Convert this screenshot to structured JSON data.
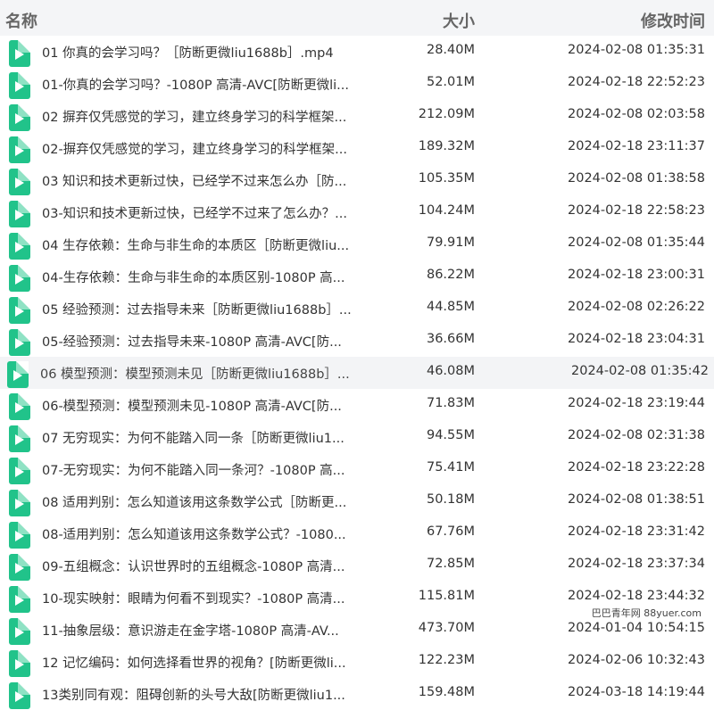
{
  "header": {
    "name": "名称",
    "size": "大小",
    "modified": "修改时间"
  },
  "files": [
    {
      "name": "01 你真的会学习吗？［防断更微liu1688b］.mp4",
      "size": "28.40M",
      "date": "2024-02-08 01:35:31"
    },
    {
      "name": "01-你真的会学习吗？-1080P 高清-AVC[防断更微li...",
      "size": "52.01M",
      "date": "2024-02-18 22:52:23"
    },
    {
      "name": "02 摒弃仅凭感觉的学习，建立终身学习的科学框架...",
      "size": "212.09M",
      "date": "2024-02-08 02:03:58"
    },
    {
      "name": "02-摒弃仅凭感觉的学习，建立终身学习的科学框架...",
      "size": "189.32M",
      "date": "2024-02-18 23:11:37"
    },
    {
      "name": "03 知识和技术更新过快，已经学不过来怎么办［防...",
      "size": "105.35M",
      "date": "2024-02-08 01:38:58"
    },
    {
      "name": "03-知识和技术更新过快，已经学不过来了怎么办？...",
      "size": "104.24M",
      "date": "2024-02-18 22:58:23"
    },
    {
      "name": "04 生存依赖：生命与非生命的本质区［防断更微liu...",
      "size": "79.91M",
      "date": "2024-02-08 01:35:44"
    },
    {
      "name": "04-生存依赖：生命与非生命的本质区别-1080P 高...",
      "size": "86.22M",
      "date": "2024-02-18 23:00:31"
    },
    {
      "name": "05 经验预测：过去指导未来［防断更微liu1688b］...",
      "size": "44.85M",
      "date": "2024-02-08 02:26:22"
    },
    {
      "name": "05-经验预测：过去指导未来-1080P 高清-AVC[防...",
      "size": "36.66M",
      "date": "2024-02-18 23:04:31"
    },
    {
      "name": "06 模型预测：模型预测未见［防断更微liu1688b］...",
      "size": "46.08M",
      "date": "2024-02-08 01:35:42"
    },
    {
      "name": "06-模型预测：模型预测未见-1080P 高清-AVC[防...",
      "size": "71.83M",
      "date": "2024-02-18 23:19:44"
    },
    {
      "name": "07 无穷现实：为何不能踏入同一条［防断更微liu1...",
      "size": "94.55M",
      "date": "2024-02-08 02:31:38"
    },
    {
      "name": "07-无穷现实：为何不能踏入同一条河？-1080P 高...",
      "size": "75.41M",
      "date": "2024-02-18 23:22:28"
    },
    {
      "name": "08 适用判别：怎么知道该用这条数学公式［防断更...",
      "size": "50.18M",
      "date": "2024-02-08 01:38:51"
    },
    {
      "name": "08-适用判别：怎么知道该用这条数学公式？-1080...",
      "size": "67.76M",
      "date": "2024-02-18 23:31:42"
    },
    {
      "name": "09-五组概念：认识世界时的五组概念-1080P 高清...",
      "size": "72.85M",
      "date": "2024-02-18 23:37:34"
    },
    {
      "name": "10-现实映射：眼睛为何看不到现实？-1080P 高清...",
      "size": "115.81M",
      "date": "2024-02-18 23:44:32"
    },
    {
      "name": "11-抽象层级：意识游走在金字塔-1080P 高清-AV...",
      "size": "473.70M",
      "date": "2024-01-04 10:54:15"
    },
    {
      "name": "12 记忆编码：如何选择看世界的视角？[防断更微li...",
      "size": "122.23M",
      "date": "2024-02-06 10:32:43"
    },
    {
      "name": "13类别同有观：阻碍创新的头号大敌[防断更微liu1...",
      "size": "159.48M",
      "date": "2024-03-18 14:19:44"
    }
  ],
  "hover_index": 10,
  "watermark": "巴巴青年网 88yuer.com",
  "colors": {
    "icon": "#21c38a",
    "header_bg": "#f4f5f7",
    "hover_bg": "#f3f4f6"
  }
}
